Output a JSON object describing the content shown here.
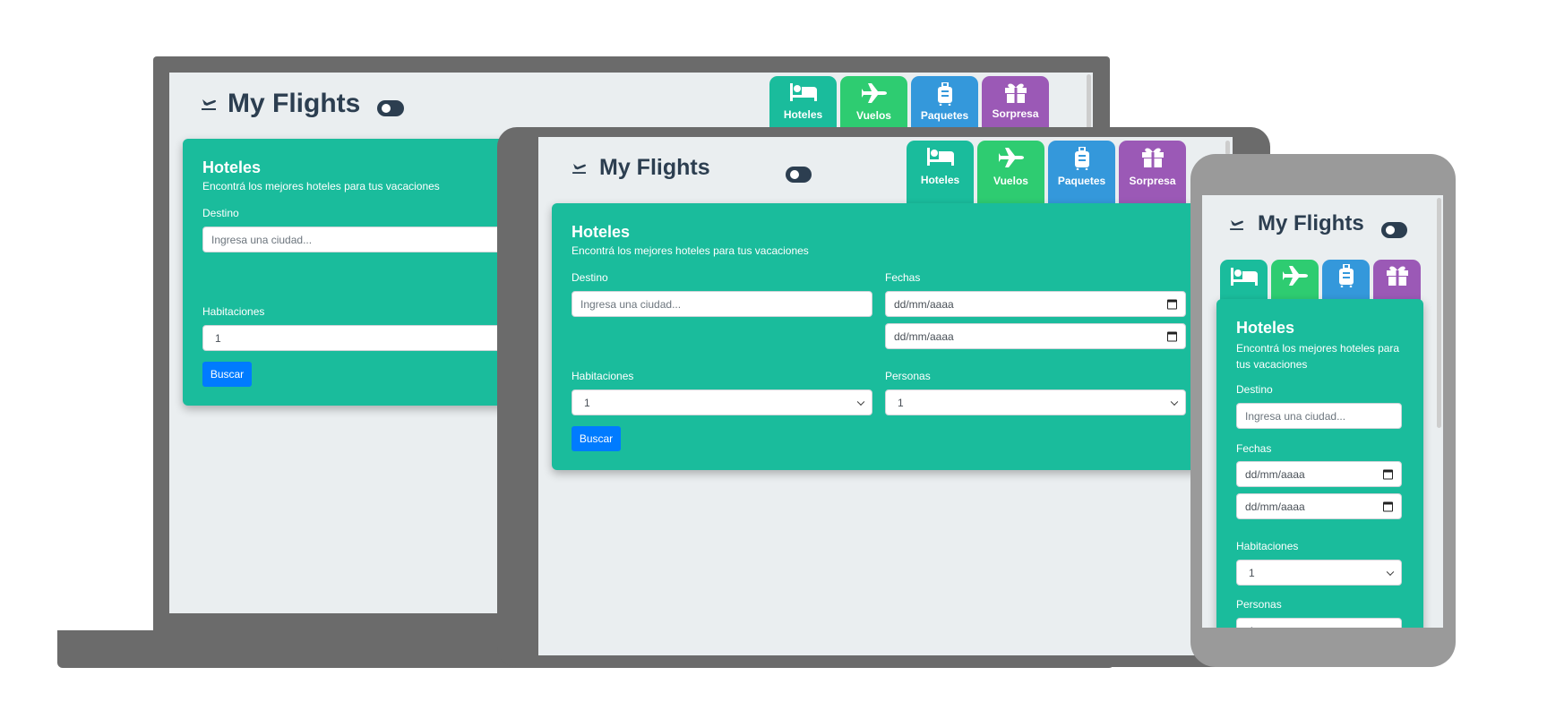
{
  "app": {
    "title": "My Flights",
    "brand_icon": "plane-departure-icon"
  },
  "tabs": [
    {
      "label": "Hoteles",
      "icon": "bed-icon",
      "color": "#1abc9c"
    },
    {
      "label": "Vuelos",
      "icon": "plane-icon",
      "color": "#2ecc71"
    },
    {
      "label": "Paquetes",
      "icon": "suitcase-icon",
      "color": "#3498db"
    },
    {
      "label": "Sorpresa",
      "icon": "gift-icon",
      "color": "#9b59b6"
    }
  ],
  "form": {
    "title": "Hoteles",
    "subtitle": "Encontrá los mejores hoteles para tus vacaciones",
    "destino_label": "Destino",
    "destino_placeholder": "Ingresa una ciudad...",
    "fechas_label": "Fechas",
    "fecha_inicio_placeholder": "dd/mm/aaaa",
    "fecha_fin_placeholder": "dd/mm/aaaa",
    "habitaciones_label": "Habitaciones",
    "habitaciones_value": "1",
    "personas_label": "Personas",
    "personas_value": "1",
    "submit_label": "Buscar"
  },
  "colors": {
    "primary": "#1abc9c",
    "header_text": "#2c3e50",
    "button": "#007bff",
    "screen_background": "#eaeef0",
    "device_frame": "#6b6b6b"
  }
}
